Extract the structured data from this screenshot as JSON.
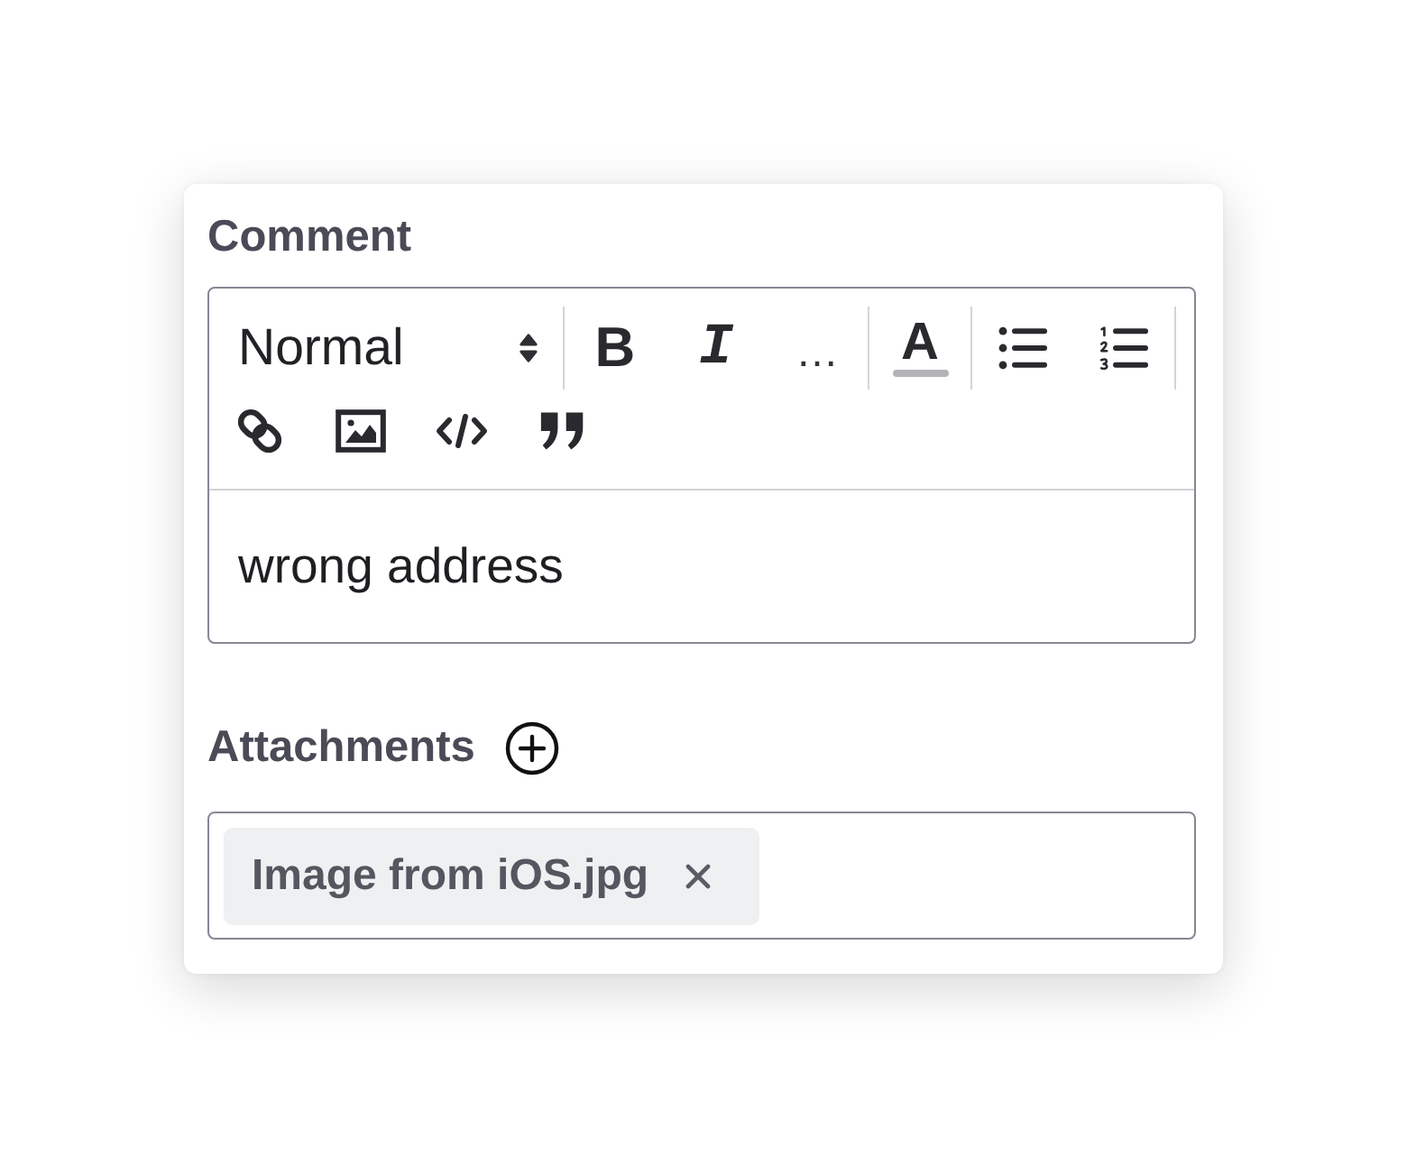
{
  "comment": {
    "label": "Comment",
    "toolbar": {
      "format": "Normal",
      "marks": [
        {
          "kind": "bold",
          "label": "B"
        },
        {
          "kind": "italic",
          "label": "I"
        },
        {
          "kind": "plain",
          "label": "…"
        }
      ],
      "color_button": {
        "label": "A"
      }
    },
    "value": "wrong address"
  },
  "attachments": {
    "label": "Attachments",
    "files": [
      {
        "name": "Image from iOS.jpg"
      }
    ]
  }
}
